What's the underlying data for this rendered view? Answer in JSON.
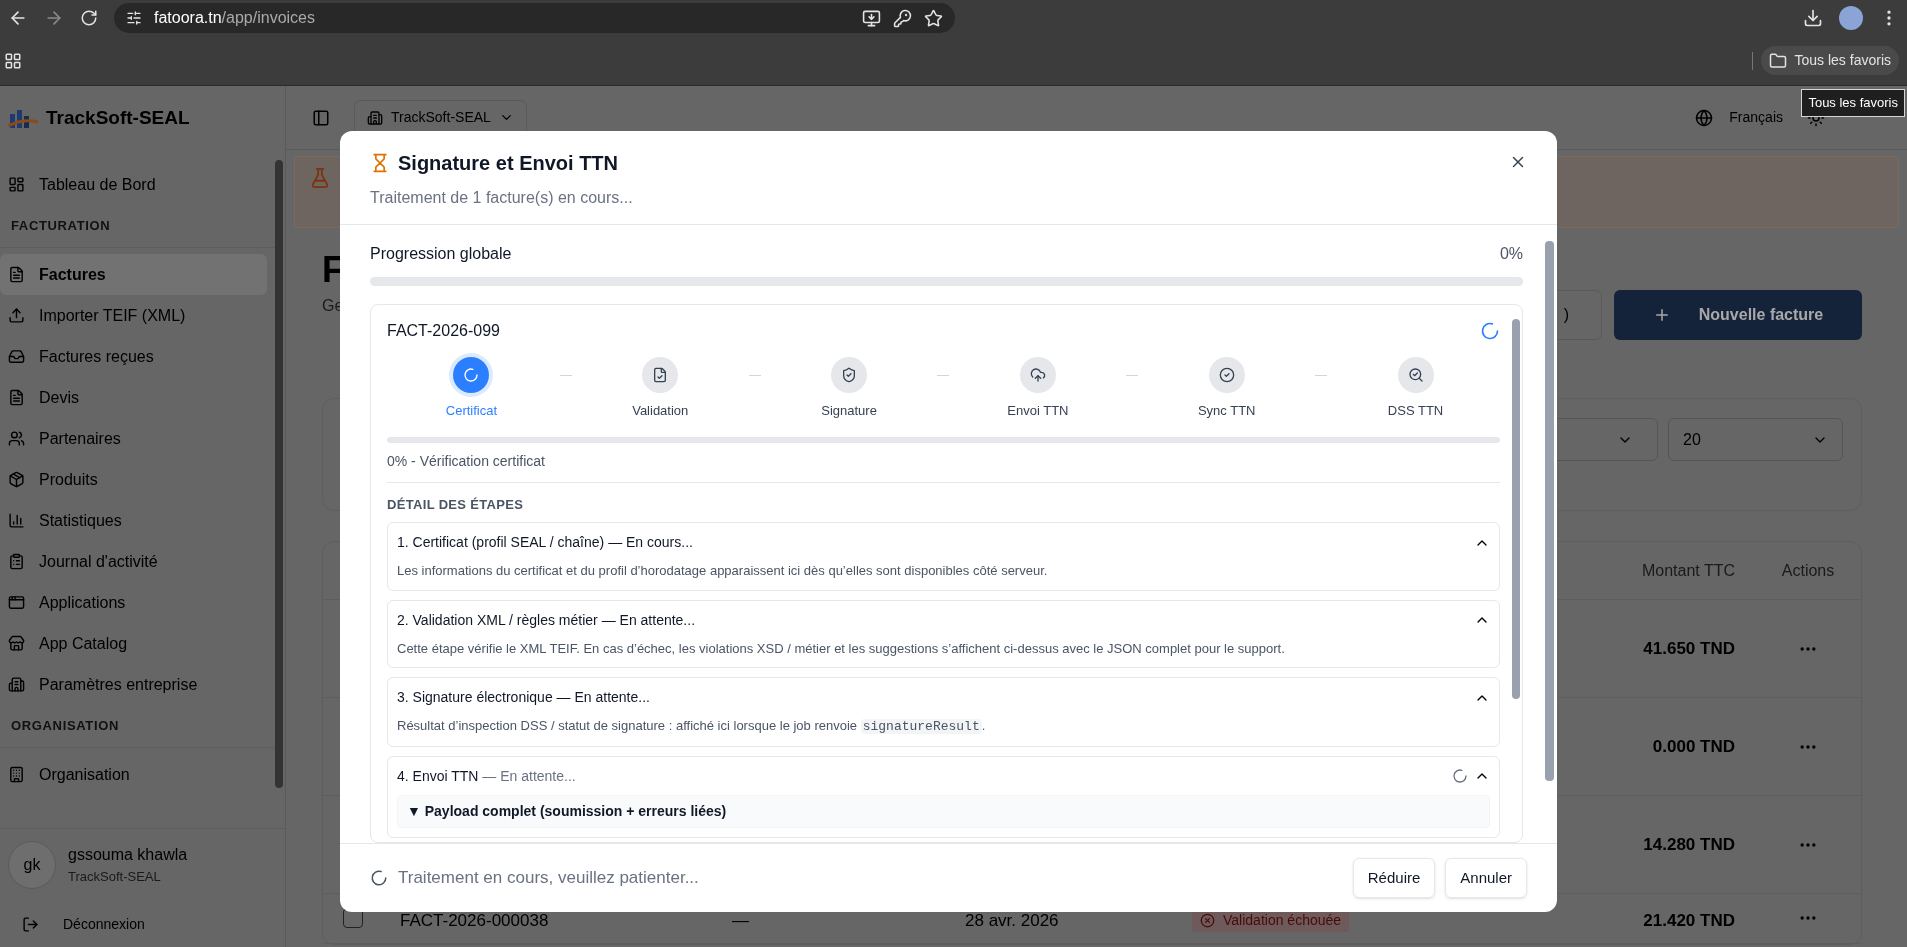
{
  "browser": {
    "url_host": "fatoora.tn",
    "url_path": "/app/invoices",
    "bookmarks_folder": "Tous les favoris",
    "tooltip": "Tous les favoris"
  },
  "sidebar": {
    "brand": "TrackSoft-SEAL",
    "groups": [
      {
        "items": [
          {
            "label": "Tableau de Bord",
            "selected": false
          }
        ]
      },
      {
        "heading": "FACTURATION",
        "items": [
          {
            "label": "Factures",
            "selected": true
          },
          {
            "label": "Importer TEIF (XML)",
            "selected": false
          },
          {
            "label": "Factures reçues",
            "selected": false
          },
          {
            "label": "Devis",
            "selected": false
          },
          {
            "label": "Partenaires",
            "selected": false
          },
          {
            "label": "Produits",
            "selected": false
          },
          {
            "label": "Statistiques",
            "selected": false
          },
          {
            "label": "Journal d'activité",
            "selected": false
          },
          {
            "label": "Applications",
            "selected": false
          },
          {
            "label": "App Catalog",
            "selected": false
          },
          {
            "label": "Paramètres entreprise",
            "selected": false
          }
        ]
      },
      {
        "heading": "ORGANISATION",
        "items": [
          {
            "label": "Organisation",
            "selected": false
          }
        ]
      }
    ],
    "user": {
      "initials": "gk",
      "name": "gssouma khawla",
      "org": "TrackSoft-SEAL"
    },
    "logout": "Déconnexion"
  },
  "header": {
    "org_selector": "TrackSoft-SEAL",
    "language": "Français"
  },
  "page": {
    "title": "F",
    "subtitle": "Ge",
    "secondary_button": ")",
    "primary_button": "Nouvelle facture",
    "page_size": "20"
  },
  "table": {
    "columns": [
      "Montant TTC",
      "Actions"
    ],
    "rows": [
      {
        "amount": "41.650 TND"
      },
      {
        "amount": "0.000 TND"
      },
      {
        "amount": "14.280 TND"
      },
      {
        "checked": false,
        "number": "FACT-2026-000038",
        "client": "—",
        "date": "28 avr. 2026",
        "status": "Validation échouée",
        "amount": "21.420 TND"
      }
    ]
  },
  "modal": {
    "title": "Signature et Envoi TTN",
    "subtitle": "Traitement de 1 facture(s) en cours...",
    "progress_label": "Progression globale",
    "progress_value": "0%",
    "level": 0,
    "invoice": {
      "number": "FACT-2026-099",
      "level": 0,
      "status_text": "0% - Vérification certificat",
      "steps": [
        {
          "label": "Certificat",
          "selected": true
        },
        {
          "label": "Validation",
          "selected": false
        },
        {
          "label": "Signature",
          "selected": false
        },
        {
          "label": "Envoi TTN",
          "selected": false
        },
        {
          "label": "Sync TTN",
          "selected": false
        },
        {
          "label": "DSS TTN",
          "selected": false
        }
      ],
      "details_heading": "DÉTAIL DES ÉTAPES",
      "details": [
        {
          "title": "1. Certificat (profil SEAL / chaîne)",
          "status": "— En cours...",
          "loading": false,
          "expanded": true,
          "body": "Les informations du certificat et du profil d’horodatage apparaissent ici dès qu’elles sont disponibles côté serveur."
        },
        {
          "title": "2. Validation XML / règles métier",
          "status": "— En attente...",
          "loading": false,
          "expanded": true,
          "body": "Cette étape vérifie le XML TEIF. En cas d’échec, les violations XSD / métier et les suggestions s’affichent ci-dessus avec le JSON complet pour le support."
        },
        {
          "title": "3. Signature électronique",
          "status": "— En attente...",
          "loading": false,
          "expanded": true,
          "body": "Résultat d’inspection DSS / statut de signature : affiché ici lorsque le job renvoie",
          "code": "signatureResult",
          "body_end": "."
        },
        {
          "title": "4. Envoi TTN",
          "status": "— En attente...",
          "loading": true,
          "expanded": true,
          "payload": "▼ Payload complet (soumission + erreurs liées)"
        }
      ]
    },
    "footer_text": "Traitement en cours, veuillez patienter...",
    "buttons": [
      "Réduire",
      "Annuler"
    ]
  }
}
